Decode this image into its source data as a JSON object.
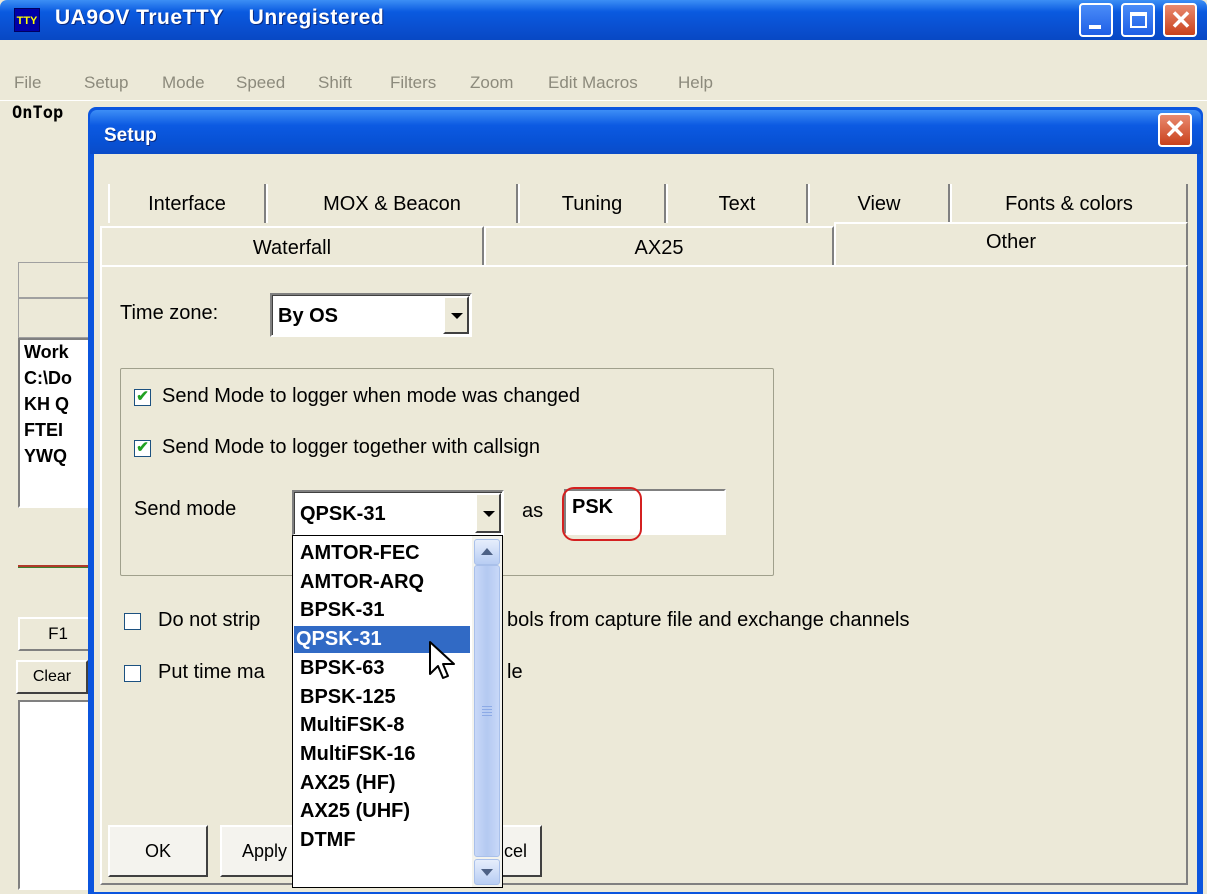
{
  "main_window": {
    "app_icon": "TTY",
    "title": "UA9OV TrueTTY    Unregistered",
    "menu": [
      "File",
      "Setup",
      "Mode",
      "Speed",
      "Shift",
      "Filters",
      "Zoom",
      "Edit Macros",
      "Help"
    ],
    "toolbar_label": "OnTop",
    "log_lines": [
      "Work",
      "C:\\Do",
      "KH Q",
      "FTEI",
      "YWQ"
    ],
    "f1_label": "F1",
    "clear_label": "Clear"
  },
  "setup": {
    "title": "Setup",
    "close_glyph": "✕",
    "tabs_row1": [
      "Interface",
      "MOX & Beacon",
      "Tuning",
      "Text",
      "View",
      "Fonts & colors"
    ],
    "tabs_row2": [
      "Waterfall",
      "AX25",
      "Other"
    ],
    "active_tab": "Other",
    "time_zone": {
      "label": "Time zone:",
      "value": "By OS"
    },
    "options": {
      "send_mode_on_change": {
        "label": "Send Mode to logger when mode was changed",
        "checked": true
      },
      "send_mode_with_callsign": {
        "label": "Send Mode to logger together with callsign",
        "checked": true
      },
      "send_mode_label": "Send mode",
      "send_mode_value": "QPSK-31",
      "as_label": "as",
      "as_value": "PSK",
      "do_not_strip": {
        "label_left": "Do not strip",
        "label_right": "bols from capture file and exchange channels",
        "checked": false
      },
      "put_time": {
        "label_left": "Put time ma",
        "label_right": "le",
        "checked": false
      }
    },
    "buttons": {
      "ok": "OK",
      "apply": "Apply",
      "cancel": "cel"
    },
    "mode_list": {
      "items": [
        "AMTOR-FEC",
        "AMTOR-ARQ",
        "BPSK-31",
        "QPSK-31",
        "BPSK-63",
        "BPSK-125",
        "MultiFSK-8",
        "MultiFSK-16",
        "AX25 (HF)",
        "AX25 (UHF)",
        "DTMF"
      ],
      "selected": "QPSK-31"
    },
    "highlight_color": "#d42020",
    "selection_color": "#316ac5"
  }
}
